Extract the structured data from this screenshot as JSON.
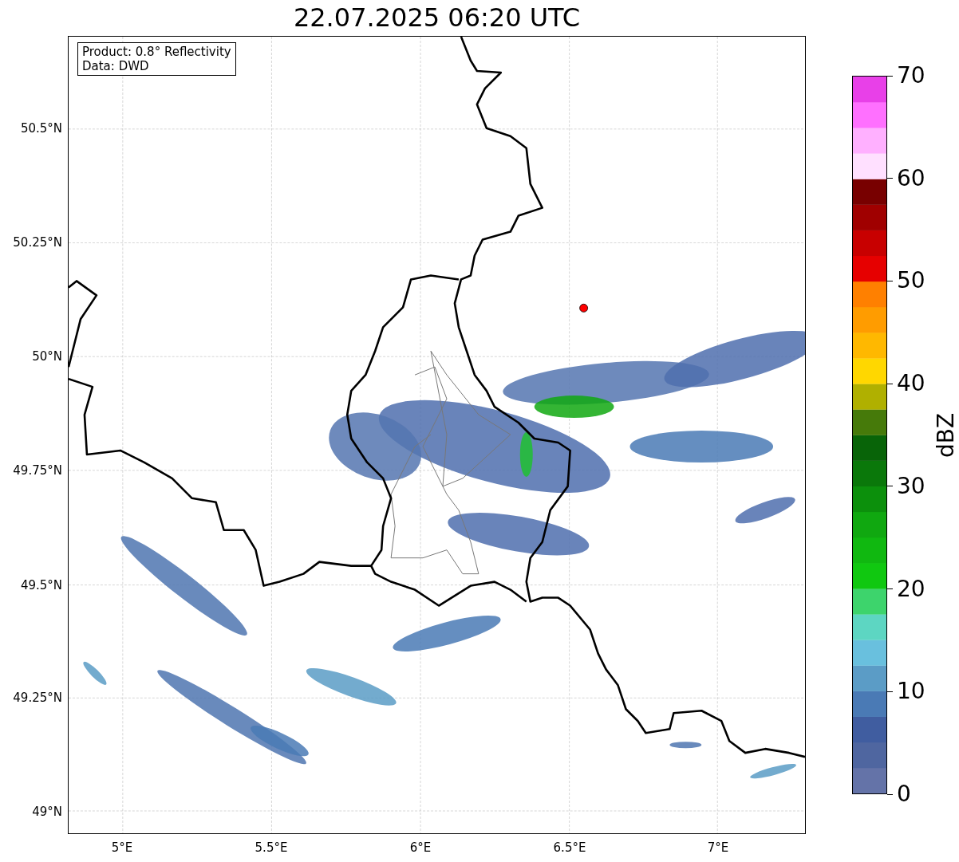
{
  "title": "22.07.2025 06:20 UTC",
  "legend": [
    "Product: 0.8° Reflectivity",
    "Data: DWD"
  ],
  "y_ticks": [
    "50.5°N",
    "50.25°N",
    "50°N",
    "49.75°N",
    "49.5°N",
    "49.25°N",
    "49°N"
  ],
  "x_ticks": [
    "5°E",
    "5.5°E",
    "6°E",
    "6.5°E",
    "7°E"
  ],
  "colorbar": {
    "label": "dBZ",
    "ticks": [
      "70",
      "60",
      "50",
      "40",
      "30",
      "20",
      "10",
      "0"
    ],
    "bins": [
      {
        "color": "#6473a8"
      },
      {
        "color": "#4f66a0"
      },
      {
        "color": "#405da0"
      },
      {
        "color": "#4a7ab5"
      },
      {
        "color": "#5b9cc6"
      },
      {
        "color": "#69c0de"
      },
      {
        "color": "#5dd6c2"
      },
      {
        "color": "#3dd46c"
      },
      {
        "color": "#10c810"
      },
      {
        "color": "#10b810"
      },
      {
        "color": "#10a810"
      },
      {
        "color": "#0c900c"
      },
      {
        "color": "#0a780a"
      },
      {
        "color": "#086408"
      },
      {
        "color": "#467a0a"
      },
      {
        "color": "#b0b000"
      },
      {
        "color": "#ffd700"
      },
      {
        "color": "#ffb800"
      },
      {
        "color": "#ff9c00"
      },
      {
        "color": "#ff8000"
      },
      {
        "color": "#e60000"
      },
      {
        "color": "#c80000"
      },
      {
        "color": "#a00000"
      },
      {
        "color": "#780000"
      },
      {
        "color": "#ffe0ff"
      },
      {
        "color": "#ffb0ff"
      },
      {
        "color": "#ff70ff"
      },
      {
        "color": "#e840e8"
      }
    ]
  }
}
